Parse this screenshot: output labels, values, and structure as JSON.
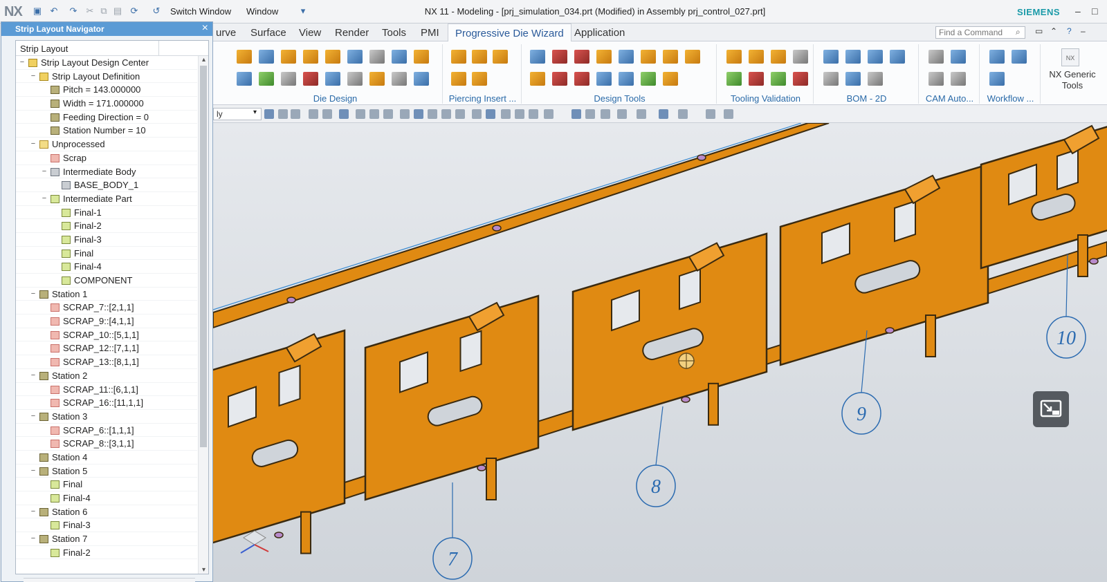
{
  "titlebar": {
    "logo": "NX",
    "switch_window": "Switch Window",
    "window_menu": "Window",
    "title": "NX 11 - Modeling - [prj_simulation_034.prt (Modified)  in Assembly prj_control_027.prt]",
    "brand": "SIEMENS"
  },
  "tabs": [
    {
      "label": "urve"
    },
    {
      "label": "Surface"
    },
    {
      "label": "View"
    },
    {
      "label": "Render"
    },
    {
      "label": "Tools"
    },
    {
      "label": "PMI"
    },
    {
      "label": "Progressive Die Wizard",
      "active": true
    },
    {
      "label": "Application"
    }
  ],
  "search": {
    "placeholder": "Find a Command"
  },
  "ribbon_groups": [
    {
      "label": "Die Design"
    },
    {
      "label": "Piercing Insert ..."
    },
    {
      "label": "Design Tools"
    },
    {
      "label": "Tooling Validation"
    },
    {
      "label": "BOM - 2D"
    },
    {
      "label": "CAM Auto..."
    },
    {
      "label": "Workflow ..."
    }
  ],
  "nx_generic_tools": {
    "line1": "NX Generic",
    "line2": "Tools"
  },
  "toolbar2": {
    "filter_value": "ly"
  },
  "navigator": {
    "title": "Strip Layout Navigator",
    "column_header": "Strip Layout",
    "rows": [
      {
        "label": "Strip Layout Design Center",
        "level": 0,
        "expand": "−",
        "icon": "center"
      },
      {
        "label": "Strip Layout Definition",
        "level": 1,
        "expand": "−",
        "icon": "center"
      },
      {
        "label": "Pitch = 143.000000",
        "level": 2,
        "expand": "",
        "icon": "param"
      },
      {
        "label": "Width = 171.000000",
        "level": 2,
        "expand": "",
        "icon": "param"
      },
      {
        "label": "Feeding Direction = 0",
        "level": 2,
        "expand": "",
        "icon": "param"
      },
      {
        "label": "Station Number = 10",
        "level": 2,
        "expand": "",
        "icon": "param"
      },
      {
        "label": "Unprocessed",
        "level": 1,
        "expand": "−",
        "icon": "folder"
      },
      {
        "label": "Scrap",
        "level": 2,
        "expand": "",
        "icon": "scrap"
      },
      {
        "label": "Intermediate Body",
        "level": 2,
        "expand": "−",
        "icon": "body"
      },
      {
        "label": "BASE_BODY_1",
        "level": 3,
        "expand": "",
        "icon": "body"
      },
      {
        "label": "Intermediate Part",
        "level": 2,
        "expand": "−",
        "icon": "part"
      },
      {
        "label": "Final-1",
        "level": 3,
        "expand": "",
        "icon": "part"
      },
      {
        "label": "Final-2",
        "level": 3,
        "expand": "",
        "icon": "part"
      },
      {
        "label": "Final-3",
        "level": 3,
        "expand": "",
        "icon": "part"
      },
      {
        "label": "Final",
        "level": 3,
        "expand": "",
        "icon": "part"
      },
      {
        "label": "Final-4",
        "level": 3,
        "expand": "",
        "icon": "part"
      },
      {
        "label": "COMPONENT",
        "level": 3,
        "expand": "",
        "icon": "part"
      },
      {
        "label": "Station 1",
        "level": 1,
        "expand": "−",
        "icon": "param"
      },
      {
        "label": "SCRAP_7::[2,1,1]",
        "level": 2,
        "expand": "",
        "icon": "scrap"
      },
      {
        "label": "SCRAP_9::[4,1,1]",
        "level": 2,
        "expand": "",
        "icon": "scrap"
      },
      {
        "label": "SCRAP_10::[5,1,1]",
        "level": 2,
        "expand": "",
        "icon": "scrap"
      },
      {
        "label": "SCRAP_12::[7,1,1]",
        "level": 2,
        "expand": "",
        "icon": "scrap"
      },
      {
        "label": "SCRAP_13::[8,1,1]",
        "level": 2,
        "expand": "",
        "icon": "scrap"
      },
      {
        "label": "Station 2",
        "level": 1,
        "expand": "−",
        "icon": "param"
      },
      {
        "label": "SCRAP_11::[6,1,1]",
        "level": 2,
        "expand": "",
        "icon": "scrap"
      },
      {
        "label": "SCRAP_16::[11,1,1]",
        "level": 2,
        "expand": "",
        "icon": "scrap"
      },
      {
        "label": "Station 3",
        "level": 1,
        "expand": "−",
        "icon": "param"
      },
      {
        "label": "SCRAP_6::[1,1,1]",
        "level": 2,
        "expand": "",
        "icon": "scrap"
      },
      {
        "label": "SCRAP_8::[3,1,1]",
        "level": 2,
        "expand": "",
        "icon": "scrap"
      },
      {
        "label": "Station 4",
        "level": 1,
        "expand": "",
        "icon": "param"
      },
      {
        "label": "Station 5",
        "level": 1,
        "expand": "−",
        "icon": "param"
      },
      {
        "label": "Final",
        "level": 2,
        "expand": "",
        "icon": "part"
      },
      {
        "label": "Final-4",
        "level": 2,
        "expand": "",
        "icon": "part"
      },
      {
        "label": "Station 6",
        "level": 1,
        "expand": "−",
        "icon": "param"
      },
      {
        "label": "Final-3",
        "level": 2,
        "expand": "",
        "icon": "part"
      },
      {
        "label": "Station 7",
        "level": 1,
        "expand": "−",
        "icon": "param"
      },
      {
        "label": "Final-2",
        "level": 2,
        "expand": "",
        "icon": "part"
      }
    ]
  },
  "viewport": {
    "strip_color": "#e08a12",
    "strip_edge_color": "#3a2a10",
    "background_top": "#e6e9ed",
    "background_bottom": "#cfd4da",
    "leader_color": "#2a6ab0",
    "station_callouts": [
      "7",
      "8",
      "9",
      "10"
    ]
  }
}
